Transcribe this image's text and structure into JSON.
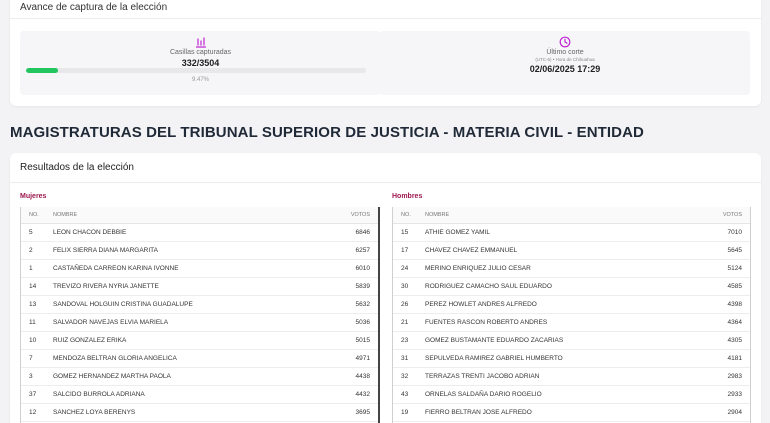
{
  "progress": {
    "title": "Avance de captura de la elección",
    "casillas_label": "Casillas capturadas",
    "casillas_value": "332/3504",
    "percent_label": "9.47%",
    "percent": 9.47,
    "corte_label": "Último corte",
    "corte_timezone": "(UTC-6) • Hora de Chihuahua",
    "corte_value": "02/06/2025 17:29"
  },
  "colors": {
    "progress_fill": "#22c55e",
    "accent": "#9d174d",
    "icon": "#c026d3"
  },
  "heading": "MAGISTRATURAS DEL TRIBUNAL SUPERIOR DE JUSTICIA - MATERIA CIVIL - ENTIDAD",
  "results": {
    "title": "Resultados de la elección",
    "columns": {
      "no": "NO.",
      "name": "NOMBRE",
      "votes": "VOTOS"
    },
    "mujeres": {
      "label": "Mujeres",
      "rows": [
        {
          "no": "5",
          "name": "LEON CHACON DEBBIE",
          "votes": "6846"
        },
        {
          "no": "2",
          "name": "FELIX SIERRA DIANA MARGARITA",
          "votes": "6257"
        },
        {
          "no": "1",
          "name": "CASTAÑEDA CARREON KARINA IVONNE",
          "votes": "6010"
        },
        {
          "no": "14",
          "name": "TREVIZO RIVERA NYRIA JANETTE",
          "votes": "5839"
        },
        {
          "no": "13",
          "name": "SANDOVAL HOLGUIN CRISTINA GUADALUPE",
          "votes": "5632"
        },
        {
          "no": "11",
          "name": "SALVADOR NAVEJAS ELVIA MARIELA",
          "votes": "5036"
        },
        {
          "no": "10",
          "name": "RUIZ GONZALEZ ERIKA",
          "votes": "5015"
        },
        {
          "no": "7",
          "name": "MENDOZA BELTRAN GLORIA ANGELICA",
          "votes": "4971"
        },
        {
          "no": "3",
          "name": "GOMEZ HERNANDEZ MARTHA PAOLA",
          "votes": "4438"
        },
        {
          "no": "37",
          "name": "SALCIDO BURROLA ADRIANA",
          "votes": "4432"
        },
        {
          "no": "12",
          "name": "SANCHEZ LOYA BERENYS",
          "votes": "3695"
        }
      ]
    },
    "hombres": {
      "label": "Hombres",
      "rows": [
        {
          "no": "15",
          "name": "ATHIE GOMEZ YAMIL",
          "votes": "7010"
        },
        {
          "no": "17",
          "name": "CHAVEZ CHAVEZ EMMANUEL",
          "votes": "5645"
        },
        {
          "no": "24",
          "name": "MERINO ENRIQUEZ JULIO CESAR",
          "votes": "5124"
        },
        {
          "no": "30",
          "name": "RODRIGUEZ CAMACHO SAUL EDUARDO",
          "votes": "4585"
        },
        {
          "no": "26",
          "name": "PEREZ HOWLET ANDRES ALFREDO",
          "votes": "4398"
        },
        {
          "no": "21",
          "name": "FUENTES RASCON ROBERTO ANDRES",
          "votes": "4364"
        },
        {
          "no": "23",
          "name": "GOMEZ BUSTAMANTE EDUARDO ZACARIAS",
          "votes": "4305"
        },
        {
          "no": "31",
          "name": "SEPULVEDA RAMIREZ GABRIEL HUMBERTO",
          "votes": "4181"
        },
        {
          "no": "32",
          "name": "TERRAZAS TRENTI JACOBO ADRIAN",
          "votes": "2983"
        },
        {
          "no": "43",
          "name": "ORNELAS SALDAÑA DARIO ROGELIO",
          "votes": "2933"
        },
        {
          "no": "19",
          "name": "FIERRO BELTRAN JOSE ALFREDO",
          "votes": "2904"
        }
      ]
    }
  }
}
